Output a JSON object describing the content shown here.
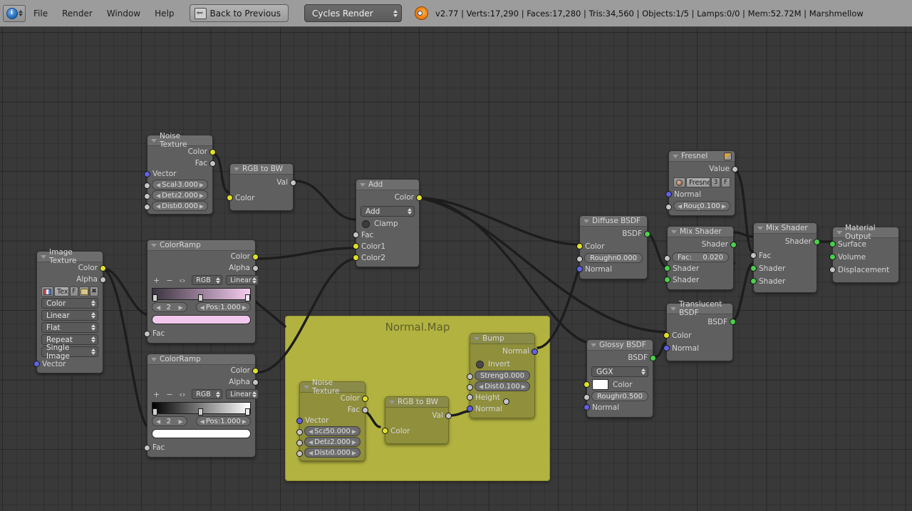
{
  "header": {
    "editor_type_icon": "node-editor-icon",
    "menus": [
      "File",
      "Render",
      "Window",
      "Help"
    ],
    "back_button": "Back to Previous",
    "engine": "Cycles Render",
    "logo": "blender-logo",
    "stats": "v2.77 | Verts:17,290 | Faces:17,280 | Tris:34,560 | Objects:1/5 | Lamps:0/0 | Mem:52.72M | Marshmellow"
  },
  "frames": [
    {
      "label": "Normal.Map",
      "color": "#b2b240"
    }
  ],
  "nodes": {
    "noise_top": {
      "title": "Noise Texture",
      "outputs": [
        "Color",
        "Fac"
      ],
      "input_vector": "Vector",
      "fields": [
        {
          "label": "Scale:",
          "value": "3.000"
        },
        {
          "label": "Detail:",
          "value": "2.000"
        },
        {
          "label": "Distortio",
          "value": "0.000"
        }
      ]
    },
    "rgb2bw_top": {
      "title": "RGB to BW",
      "output": "Val",
      "input": "Color"
    },
    "add_mix": {
      "title": "Add",
      "output": "Color",
      "blend_mode": "Add",
      "clamp": "Clamp",
      "inputs": [
        "Fac",
        "Color1",
        "Color2"
      ]
    },
    "image_texture": {
      "title": "Image Texture",
      "outputs": [
        "Color",
        "Alpha"
      ],
      "datablock_name": "Textu",
      "fake_user": "F",
      "dropdowns": [
        "Color",
        "Linear",
        "Flat",
        "Repeat",
        "Single Image"
      ],
      "input_vector": "Vector"
    },
    "colorramp_pink": {
      "title": "ColorRamp",
      "outputs": [
        "Color",
        "Alpha"
      ],
      "interp_color": "RGB",
      "interp_mode": "Linear",
      "index": "2",
      "pos_label": "Pos:",
      "pos_value": "1.000",
      "swatch": "#f3c8ee",
      "gradient_from": "#3b3340",
      "gradient_to": "#f6cdf0",
      "input": "Fac"
    },
    "colorramp_bw": {
      "title": "ColorRamp",
      "outputs": [
        "Color",
        "Alpha"
      ],
      "interp_color": "RGB",
      "interp_mode": "Linear",
      "index": "2",
      "pos_label": "Pos:",
      "pos_value": "1.000",
      "swatch": "#ffffff",
      "gradient_from": "#000000",
      "gradient_to": "#ffffff",
      "input": "Fac"
    },
    "noise_normalmap": {
      "title": "Noise Texture",
      "outputs": [
        "Color",
        "Fac"
      ],
      "input_vector": "Vector",
      "fields": [
        {
          "label": "Scale:",
          "value": "50.000"
        },
        {
          "label": "Detail:",
          "value": "2.000"
        },
        {
          "label": "Distortio",
          "value": "0.000"
        }
      ]
    },
    "rgb2bw_normalmap": {
      "title": "RGB to BW",
      "output": "Val",
      "input": "Color"
    },
    "bump": {
      "title": "Bump",
      "output": "Normal",
      "invert": "Invert",
      "fields": [
        {
          "label": "Strength:",
          "value": "0.000"
        },
        {
          "label": "Distance",
          "value": "0.100"
        }
      ],
      "inputs": [
        "Height",
        "Normal"
      ]
    },
    "diffuse": {
      "title": "Diffuse BSDF",
      "output": "BSDF",
      "input_color": "Color",
      "roughness_label": "Roughnes:",
      "roughness_value": "0.000",
      "input_normal": "Normal"
    },
    "glossy": {
      "title": "Glossy BSDF",
      "output": "BSDF",
      "distribution": "GGX",
      "color_label": "Color",
      "color_swatch": "#ffffff",
      "roughness_label": "Roughnes:",
      "roughness_value": "0.500",
      "input_normal": "Normal"
    },
    "translucent": {
      "title": "Translucent BSDF",
      "output": "BSDF",
      "inputs": [
        "Color",
        "Normal"
      ]
    },
    "fresnel": {
      "title": "Fresnel",
      "output": "Value",
      "group_name": "Fresne",
      "group_users": "3",
      "fake_user": "F",
      "input_normal": "Normal",
      "roughness_label": "Roughn:",
      "roughness_value": "0.100"
    },
    "mix_shader_1": {
      "title": "Mix Shader",
      "output": "Shader",
      "fac_label": "Fac:",
      "fac_value": "0.020",
      "inputs": [
        "Shader",
        "Shader"
      ]
    },
    "mix_shader_2": {
      "title": "Mix Shader",
      "output": "Shader",
      "inputs": [
        "Fac",
        "Shader",
        "Shader"
      ]
    },
    "material_output": {
      "title": "Material Output",
      "inputs": [
        "Surface",
        "Volume",
        "Displacement"
      ]
    }
  }
}
